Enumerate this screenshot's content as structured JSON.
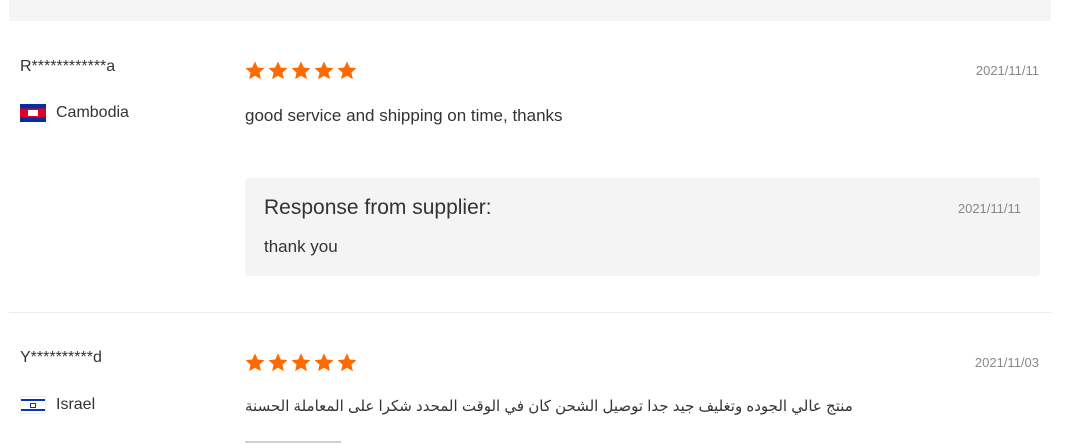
{
  "reviews": [
    {
      "user": "R************a",
      "country": "Cambodia",
      "flag": "cambodia-flag-icon",
      "rating": 5,
      "date": "2021/11/11",
      "text": "good service and shipping on time, thanks",
      "response": {
        "title": "Response from supplier:",
        "date": "2021/11/11",
        "text": "thank you"
      }
    },
    {
      "user": "Y**********d",
      "country": "Israel",
      "flag": "israel-flag-icon",
      "rating": 5,
      "date": "2021/11/03",
      "text": "منتج عالي الجوده وتغليف جيد جدا توصيل الشحن كان في الوقت المحدد شكرا على المعاملة الحسنة"
    }
  ],
  "colors": {
    "star": "#ff6a00",
    "response_bg": "#f4f4f4",
    "date": "#888888",
    "text": "#333333"
  }
}
